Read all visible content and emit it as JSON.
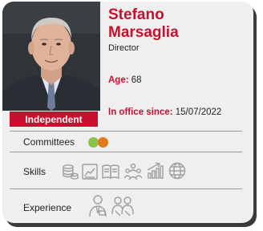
{
  "profile": {
    "first_name": "Stefano",
    "last_name": "Marsaglia",
    "role": "Director",
    "badge": "Independent",
    "age_label": "Age:",
    "age_value": "68",
    "office_label": "In office since:",
    "office_value": "15/07/2022"
  },
  "sections": {
    "committees_label": "Committees",
    "skills_label": "Skills",
    "experience_label": "Experience"
  },
  "committees": [
    {
      "color": "#8bc34a"
    },
    {
      "color": "#e07b1f"
    }
  ],
  "skills_icons": [
    "finance-coins-icon",
    "chart-icon",
    "book-icon",
    "people-group-icon",
    "growth-chart-icon",
    "globe-icon"
  ],
  "experience_icons": [
    "professional-person-icon",
    "team-icon"
  ],
  "colors": {
    "accent": "#c8102e",
    "card_bg": "#efefef",
    "icon_gray": "#9e9e9e"
  }
}
